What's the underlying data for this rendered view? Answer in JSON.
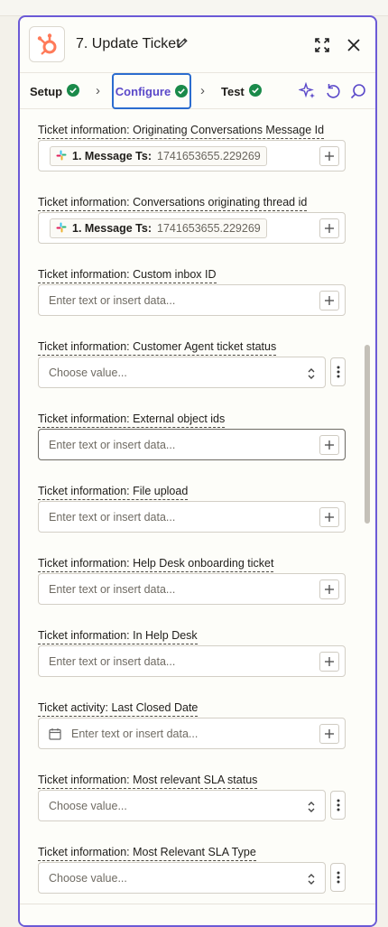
{
  "step": {
    "title": "7. Update Ticket",
    "app_icon": "hubspot-logo",
    "brand_color": "#ff7a59",
    "accent_color": "#6b5ad6",
    "success_color": "#1a8a4a"
  },
  "tabs": [
    {
      "label": "Setup",
      "status": "complete"
    },
    {
      "label": "Configure",
      "status": "complete",
      "active": true
    },
    {
      "label": "Test",
      "status": "complete"
    }
  ],
  "fields": [
    {
      "label": "Ticket information: Originating Conversations Message Id",
      "kind": "mapped",
      "source_label": "1. Message Ts:",
      "source_value": "1741653655.229269",
      "source_icon": "slack-icon"
    },
    {
      "label": "Ticket information: Conversations originating thread id",
      "kind": "mapped",
      "source_label": "1. Message Ts:",
      "source_value": "1741653655.229269",
      "source_icon": "slack-icon"
    },
    {
      "label": "Ticket information: Custom inbox ID",
      "kind": "text",
      "placeholder": "Enter text or insert data..."
    },
    {
      "label": "Ticket information: Customer Agent ticket status",
      "kind": "select",
      "placeholder": "Choose value..."
    },
    {
      "label": "Ticket information: External object ids",
      "kind": "text",
      "placeholder": "Enter text or insert data...",
      "focused": true
    },
    {
      "label": "Ticket information: File upload",
      "kind": "text",
      "placeholder": "Enter text or insert data..."
    },
    {
      "label": "Ticket information: Help Desk onboarding ticket",
      "kind": "text",
      "placeholder": "Enter text or insert data..."
    },
    {
      "label": "Ticket information: In Help Desk",
      "kind": "text",
      "placeholder": "Enter text or insert data..."
    },
    {
      "label": "Ticket activity: Last Closed Date",
      "kind": "date",
      "placeholder": "Enter text or insert data..."
    },
    {
      "label": "Ticket information: Most relevant SLA status",
      "kind": "select",
      "placeholder": "Choose value..."
    },
    {
      "label": "Ticket information: Most Relevant SLA Type",
      "kind": "select",
      "placeholder": "Choose value..."
    }
  ]
}
